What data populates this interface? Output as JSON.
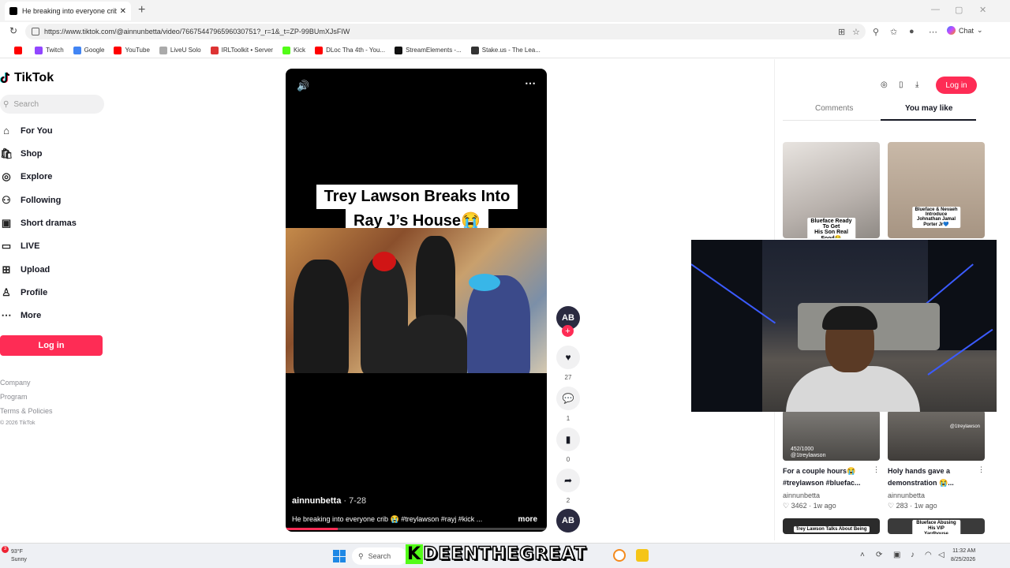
{
  "browser": {
    "tab_title": "He breaking into everyone crib 😭",
    "url": "https://www.tiktok.com/@ainnunbetta/video/7667544796596030751?_r=1&_t=ZP-99BUmXJsFIW",
    "chat_label": "Chat",
    "bookmarks": [
      {
        "label": "",
        "color": "#ff0000"
      },
      {
        "label": "Twitch",
        "color": "#9146ff"
      },
      {
        "label": "Google",
        "color": "#4285f4"
      },
      {
        "label": "YouTube",
        "color": "#ff0000"
      },
      {
        "label": "LiveU Solo",
        "color": "#aaaaaa"
      },
      {
        "label": "IRLToolkit • Server",
        "color": "#d33"
      },
      {
        "label": "Kick",
        "color": "#53fc18"
      },
      {
        "label": "DLoc Tha 4th - You...",
        "color": "#ff0000"
      },
      {
        "label": "StreamElements -...",
        "color": "#111"
      },
      {
        "label": "Stake.us - The Lea...",
        "color": "#333"
      }
    ]
  },
  "tiktok": {
    "logo_text": "TikTok",
    "search_placeholder": "Search",
    "nav": [
      {
        "label": "For You",
        "icon": "home-icon",
        "glyph": "⌂"
      },
      {
        "label": "Shop",
        "icon": "shop-icon",
        "glyph": "🛍"
      },
      {
        "label": "Explore",
        "icon": "compass-icon",
        "glyph": "◎"
      },
      {
        "label": "Following",
        "icon": "following-icon",
        "glyph": "⚇"
      },
      {
        "label": "Short dramas",
        "icon": "film-icon",
        "glyph": "▣"
      },
      {
        "label": "LIVE",
        "icon": "live-icon",
        "glyph": "▭"
      },
      {
        "label": "Upload",
        "icon": "upload-icon",
        "glyph": "⊞"
      },
      {
        "label": "Profile",
        "icon": "profile-icon",
        "glyph": "♙"
      },
      {
        "label": "More",
        "icon": "more-icon",
        "glyph": "⋯"
      }
    ],
    "login_label": "Log in",
    "footer": [
      "Company",
      "Program",
      "Terms & Policies"
    ],
    "copyright": "© 2026 TikTok"
  },
  "video": {
    "caption_line1": "Trey Lawson Breaks Into",
    "caption_line2": "Ray J’s House😭",
    "username": "ainnunbetta",
    "date": " · 7-28",
    "description": "He breaking into everyone crib 😭 #treylawson #rayj #kick ...",
    "more_label": "more",
    "progress": 0.2
  },
  "actions": {
    "avatar_text": "AB",
    "likes": "27",
    "comments": "1",
    "saves": "0",
    "shares": "2"
  },
  "right_panel": {
    "login_label": "Log in",
    "tab_comments": "Comments",
    "tab_you_may_like": "You may like",
    "thumb1_label": "Blueface Ready To Get\nHis Son Real Food😂",
    "thumb2_label": "Blueface & Nevaeh Introduce\nJohnathan Jamal Porter Jr💙",
    "thumb3_overlay": "452/1000\n@1treylawson",
    "thumb4_overlay": "@1treylawson",
    "card1": {
      "title1": "For a couple hours😭",
      "title2": "#treylawson #bluefac...",
      "author": "ainnunbetta",
      "stats": "♡ 3462  · 1w ago"
    },
    "card2": {
      "title1": "Holy hands gave a",
      "title2": "demonstration 😭...",
      "author": "ainnunbetta",
      "stats": "♡ 283  · 1w ago"
    },
    "thumb5_label": "Trey Lawson Talks About Being",
    "thumb6_label": "Blueface Abusing His VIP\nYardhouse Treatment😭"
  },
  "taskbar": {
    "weather_temp": "93°F",
    "weather_cond": "Sunny",
    "weather_badge": "3",
    "search_label": "Search",
    "streamer_k": "K",
    "streamer_name": "DEENTHEGREAT",
    "time": "11:32 AM",
    "date": "8/25/2026"
  }
}
